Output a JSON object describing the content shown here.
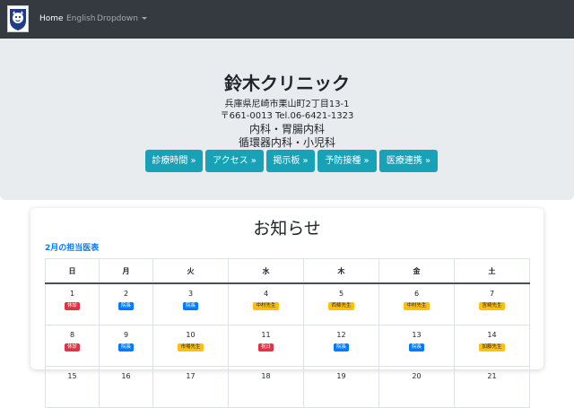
{
  "nav": {
    "items": [
      {
        "label": "Home",
        "active": true
      },
      {
        "label": "English",
        "active": false
      },
      {
        "label": "Dropdown",
        "active": false
      }
    ]
  },
  "header": {
    "clinic_name": "鈴木クリニック",
    "address": "兵庫県尼崎市栗山町2丁目13-1",
    "contact": "〒661-0013 Tel.06-6421-1323",
    "specialty_1": "内科・胃腸内科",
    "specialty_2": "循環器内科・小児科",
    "buttons": [
      {
        "label": "診療時間 »"
      },
      {
        "label": "アクセス »"
      },
      {
        "label": "掲示板 »"
      },
      {
        "label": "予防接種 »"
      },
      {
        "label": "医療連携 »"
      }
    ]
  },
  "notice": {
    "title": "お知らせ",
    "month_link": "2月の担当医表",
    "weekdays": [
      "日",
      "月",
      "火",
      "水",
      "木",
      "金",
      "土"
    ],
    "weeks": [
      [
        {
          "day": "1",
          "badge": "休診",
          "color": "red"
        },
        {
          "day": "2",
          "badge": "院長",
          "color": "blue"
        },
        {
          "day": "3",
          "badge": "院長",
          "color": "blue"
        },
        {
          "day": "4",
          "badge": "中村先生",
          "color": "yellow"
        },
        {
          "day": "5",
          "badge": "西條先生",
          "color": "yellow"
        },
        {
          "day": "6",
          "badge": "中村先生",
          "color": "yellow"
        },
        {
          "day": "7",
          "badge": "宮崎先生",
          "color": "yellow"
        }
      ],
      [
        {
          "day": "8",
          "badge": "休診",
          "color": "red"
        },
        {
          "day": "9",
          "badge": "院長",
          "color": "blue"
        },
        {
          "day": "10",
          "badge": "市場先生",
          "color": "yellow"
        },
        {
          "day": "11",
          "badge": "祝日",
          "color": "red"
        },
        {
          "day": "12",
          "badge": "院長",
          "color": "blue"
        },
        {
          "day": "13",
          "badge": "院長",
          "color": "blue"
        },
        {
          "day": "14",
          "badge": "加藤先生",
          "color": "yellow"
        }
      ],
      [
        {
          "day": "15",
          "badge": "",
          "color": ""
        },
        {
          "day": "16",
          "badge": "",
          "color": ""
        },
        {
          "day": "17",
          "badge": "",
          "color": ""
        },
        {
          "day": "18",
          "badge": "",
          "color": ""
        },
        {
          "day": "19",
          "badge": "",
          "color": ""
        },
        {
          "day": "20",
          "badge": "",
          "color": ""
        },
        {
          "day": "21",
          "badge": "",
          "color": ""
        }
      ]
    ]
  },
  "colors": {
    "navbar": "#343a40",
    "jumbotron": "#e9ecef",
    "button": "#17a2b8",
    "link": "#007bff",
    "badge_red": "#dc3545",
    "badge_blue": "#007bff",
    "badge_yellow": "#ffc107"
  },
  "icons": {
    "logo": "tiger-crest-logo-icon",
    "dropdown": "caret-down-icon"
  }
}
